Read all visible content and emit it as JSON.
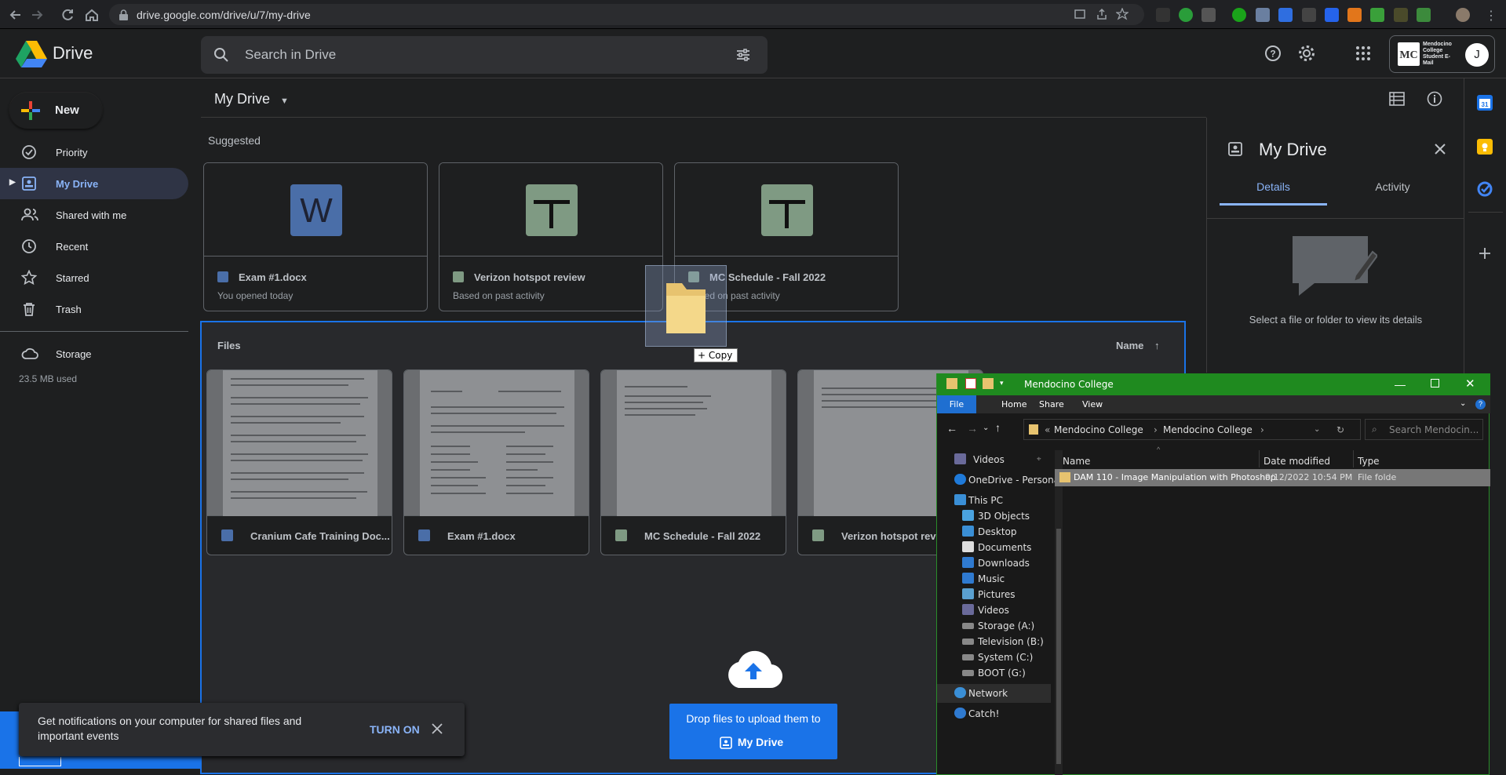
{
  "browser": {
    "url": "drive.google.com/drive/u/7/my-drive"
  },
  "app": {
    "name": "Drive",
    "search_placeholder": "Search in Drive",
    "account_badge": "Mendocino College Student E-Mail",
    "avatar_letter": "J"
  },
  "sidebar": {
    "new_label": "New",
    "items": [
      {
        "label": "Priority",
        "icon": "check-circle-icon"
      },
      {
        "label": "My Drive",
        "icon": "my-drive-icon"
      },
      {
        "label": "Shared with me",
        "icon": "people-icon"
      },
      {
        "label": "Recent",
        "icon": "clock-icon"
      },
      {
        "label": "Starred",
        "icon": "star-icon"
      },
      {
        "label": "Trash",
        "icon": "trash-icon"
      }
    ],
    "storage_label": "Storage",
    "storage_used": "23.5 MB used"
  },
  "main": {
    "title": "My Drive",
    "suggested_label": "Suggested",
    "suggested": [
      {
        "title": "Exam #1.docx",
        "sub": "You opened today",
        "type": "word",
        "letter": "W"
      },
      {
        "title": "Verizon hotspot review",
        "sub": "Based on past activity",
        "type": "sheet"
      },
      {
        "title": "MC Schedule - Fall 2022",
        "sub": "Based on past activity",
        "type": "sheet"
      }
    ],
    "files_label": "Files",
    "sort_label": "Name",
    "files": [
      {
        "title": "Cranium Cafe Training Doc...",
        "type": "word"
      },
      {
        "title": "Exam #1.docx",
        "type": "word"
      },
      {
        "title": "MC Schedule - Fall 2022",
        "type": "sheet"
      },
      {
        "title": "Verizon hotspot revie",
        "type": "sheet"
      }
    ],
    "drop_text": "Drop files to upload them to",
    "drop_target": "My Drive",
    "drag_tooltip": "+ Copy"
  },
  "details": {
    "title": "My Drive",
    "tab_details": "Details",
    "tab_activity": "Activity",
    "empty_message": "Select a file or folder to view its details"
  },
  "toast": {
    "message": "Get notifications on your computer for shared files and important events",
    "action": "TURN ON"
  },
  "explorer": {
    "title": "Mendocino College",
    "ribbon": {
      "file": "File",
      "home": "Home",
      "share": "Share",
      "view": "View"
    },
    "breadcrumb": [
      "Mendocino College",
      "Mendocino College"
    ],
    "search_placeholder": "Search Mendocin...",
    "nav": [
      {
        "label": "Videos",
        "icon": "videos-icon"
      },
      {
        "label": "OneDrive - Persona",
        "icon": "onedrive-icon"
      },
      {
        "label": "This PC",
        "icon": "this-pc-icon"
      },
      {
        "label": "3D Objects",
        "icon": "3d-objects-icon"
      },
      {
        "label": "Desktop",
        "icon": "desktop-icon"
      },
      {
        "label": "Documents",
        "icon": "documents-icon"
      },
      {
        "label": "Downloads",
        "icon": "downloads-icon"
      },
      {
        "label": "Music",
        "icon": "music-icon"
      },
      {
        "label": "Pictures",
        "icon": "pictures-icon"
      },
      {
        "label": "Videos",
        "icon": "videos-icon"
      },
      {
        "label": "Storage (A:)",
        "icon": "drive-icon"
      },
      {
        "label": "Television (B:)",
        "icon": "drive-icon"
      },
      {
        "label": "System (C:)",
        "icon": "drive-icon"
      },
      {
        "label": "BOOT (G:)",
        "icon": "drive-icon"
      },
      {
        "label": "Network",
        "icon": "network-icon"
      },
      {
        "label": "Catch!",
        "icon": "catch-icon"
      }
    ],
    "columns": {
      "name": "Name",
      "date": "Date modified",
      "type": "Type"
    },
    "rows": [
      {
        "name": "DAM 110 - Image Manipulation with Photoshop",
        "date": "9/12/2022 10:54 PM",
        "type": "File folde"
      }
    ]
  },
  "colors": {
    "accent": "#8ab4f8",
    "drive_blue": "#1a73e8",
    "word": "#4a6ea8",
    "sheet": "#7f9a83",
    "explorer_title": "#1f8a1f"
  }
}
